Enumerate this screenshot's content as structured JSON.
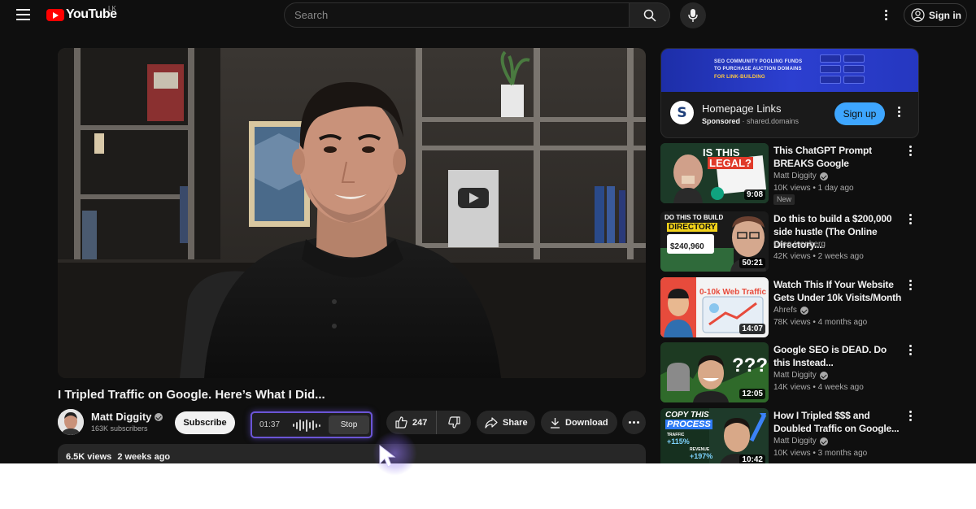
{
  "header": {
    "logo_text": "YouTube",
    "country_code": "LK",
    "search_placeholder": "Search",
    "signin_label": "Sign in"
  },
  "video": {
    "title": "I Tripled Traffic on Google. Here’s What I Did...",
    "channel": "Matt Diggity",
    "subscribers": "163K subscribers",
    "subscribe_label": "Subscribe",
    "likes": "247",
    "share_label": "Share",
    "download_label": "Download",
    "views": "6.5K views",
    "age": "2 weeks ago"
  },
  "recorder": {
    "time": "01:37",
    "stop_label": "Stop"
  },
  "ad": {
    "banner_line1": "SEO COMMUNITY POOLING FUNDS",
    "banner_line2": "TO PURCHASE AUCTION DOMAINS",
    "banner_line3": "FOR LINK-BUILDING",
    "title": "Homepage Links",
    "sponsored": "Sponsored",
    "domain": "shared.domains",
    "signup_label": "Sign up"
  },
  "recommendations": [
    {
      "title": "This ChatGPT Prompt BREAKS Google",
      "channel": "Matt Diggity",
      "verified": true,
      "views": "10K views",
      "age": "1 day ago",
      "badge": "New",
      "duration": "9:08",
      "thumb_text": [
        "IS THIS",
        "LEGAL?"
      ]
    },
    {
      "title": "Do this to build a $200,000 side hustle (The Online Directory...",
      "channel": "Greg Isenberg",
      "verified": false,
      "views": "42K views",
      "age": "2 weeks ago",
      "duration": "50:21",
      "thumb_text": [
        "DO THIS TO BUILD",
        "DIRECTORY",
        "$240,960"
      ]
    },
    {
      "title": "Watch This If Your Website Gets Under 10k Visits/Month",
      "channel": "Ahrefs",
      "verified": true,
      "views": "78K views",
      "age": "4 months ago",
      "duration": "14:07",
      "thumb_text": [
        "0-10k Web Traffic"
      ]
    },
    {
      "title": "Google SEO is DEAD. Do this Instead...",
      "channel": "Matt Diggity",
      "verified": true,
      "views": "14K views",
      "age": "4 weeks ago",
      "duration": "12:05",
      "thumb_text": [
        "???"
      ]
    },
    {
      "title": "How I Tripled $$$ and Doubled Traffic on Google...",
      "channel": "Matt Diggity",
      "verified": true,
      "views": "10K views",
      "age": "3 months ago",
      "duration": "10:42",
      "thumb_text": [
        "COPY THIS",
        "PROCESS",
        "TRAFFIC",
        "+115%",
        "REVENUE",
        "+197%"
      ]
    }
  ],
  "colors": {
    "background": "#0f0f0f",
    "brand_red": "#ff0000",
    "signup_blue": "#3ea6ff",
    "recorder_glow": "#6b55d6"
  }
}
